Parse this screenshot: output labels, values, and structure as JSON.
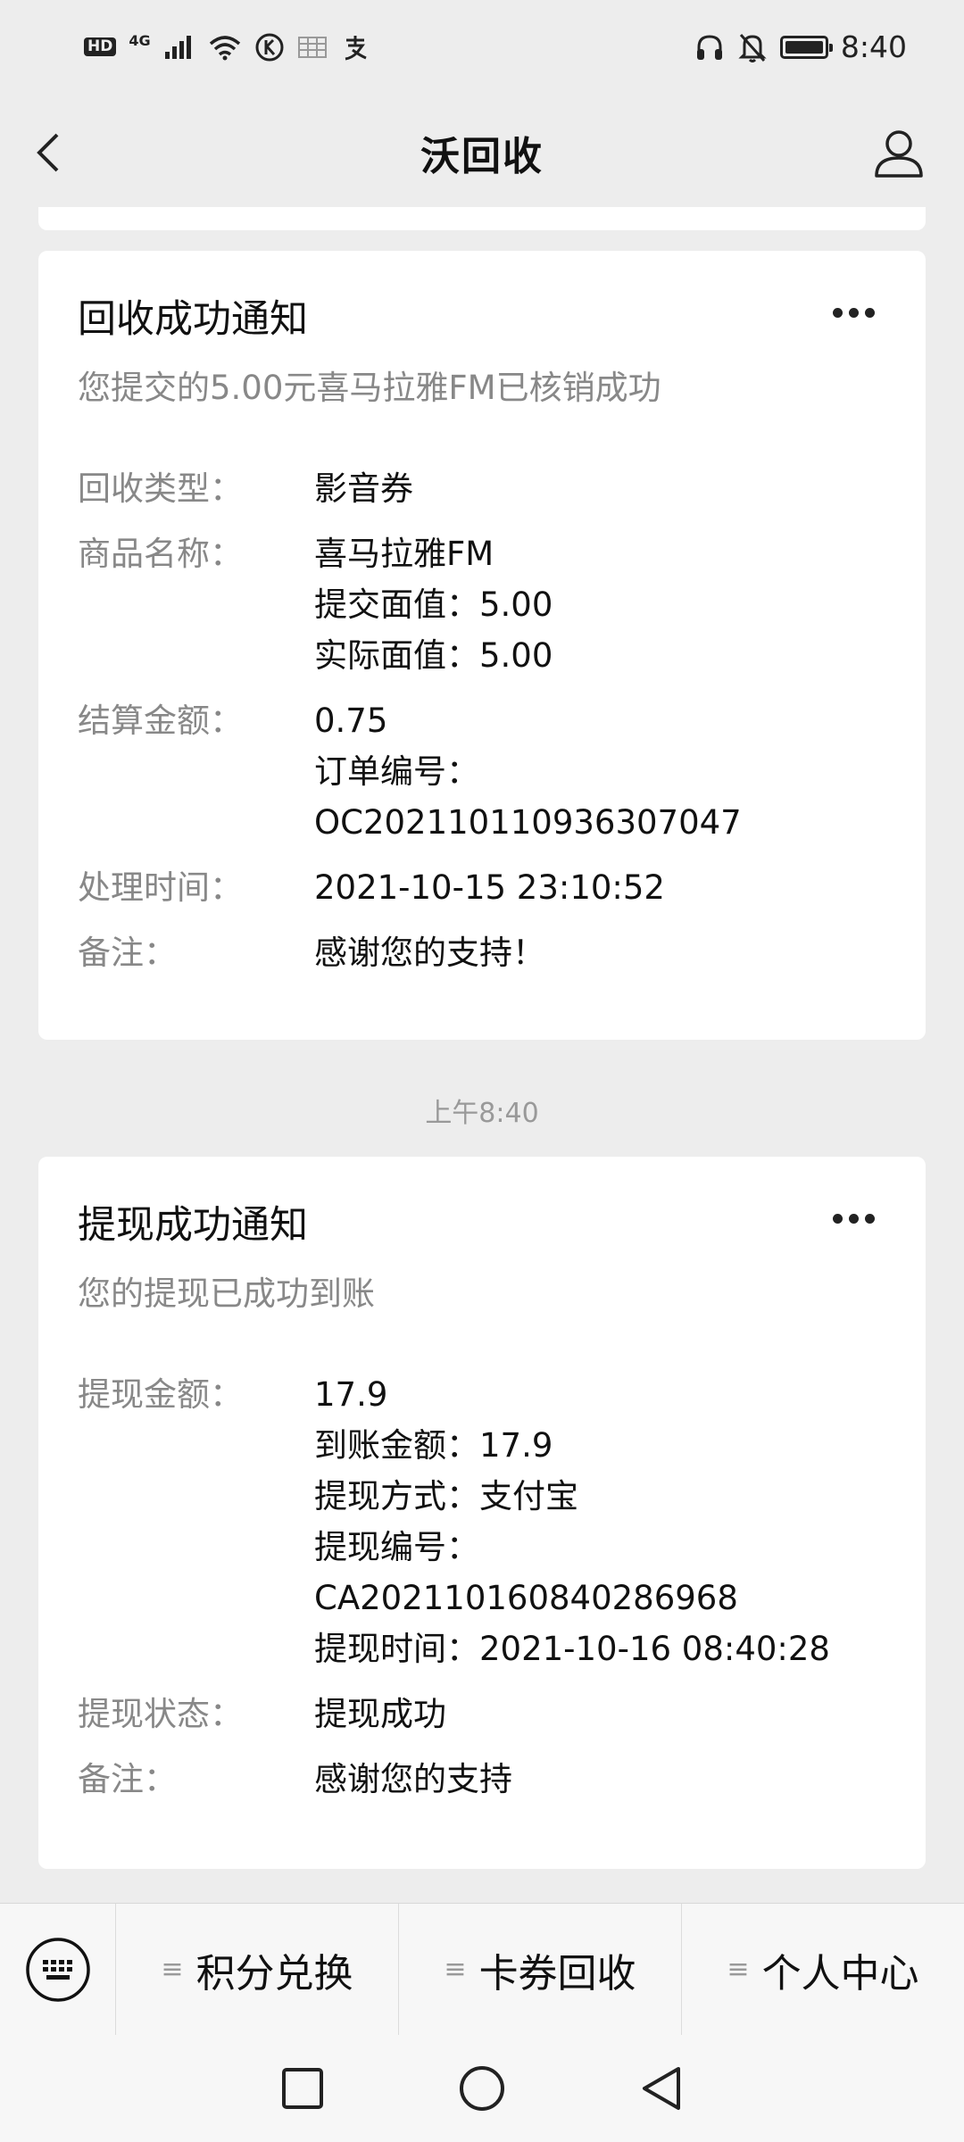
{
  "status_bar": {
    "hd": "HD",
    "network": "4G",
    "time": "8:40"
  },
  "nav": {
    "title": "沃回收"
  },
  "messages": [
    {
      "title": "回收成功通知",
      "subtitle": "您提交的5.00元喜马拉雅FM已核销成功",
      "fields": [
        {
          "label": "回收类型：",
          "lines": [
            "影音券"
          ]
        },
        {
          "label": "商品名称：",
          "lines": [
            "喜马拉雅FM",
            "提交面值：5.00",
            "实际面值：5.00"
          ]
        },
        {
          "label": "结算金额：",
          "lines": [
            "0.75",
            "订单编号：",
            "OC202110110936307047"
          ]
        },
        {
          "label": "处理时间：",
          "lines": [
            "2021-10-15 23:10:52"
          ]
        },
        {
          "label": "备注：",
          "lines": [
            "感谢您的支持！"
          ]
        }
      ]
    },
    {
      "title": "提现成功通知",
      "subtitle": "您的提现已成功到账",
      "fields": [
        {
          "label": "提现金额：",
          "lines": [
            "17.9",
            "到账金额：17.9",
            "提现方式：支付宝",
            "提现编号：",
            "CA202110160840286968",
            "提现时间：2021-10-16 08:40:28"
          ]
        },
        {
          "label": "提现状态：",
          "lines": [
            "提现成功"
          ]
        },
        {
          "label": "备注：",
          "lines": [
            "感谢您的支持"
          ]
        }
      ]
    }
  ],
  "time_divider": "上午8:40",
  "bottom_menu": {
    "items": [
      {
        "label": "积分兑换"
      },
      {
        "label": "卡券回收"
      },
      {
        "label": "个人中心"
      }
    ]
  }
}
